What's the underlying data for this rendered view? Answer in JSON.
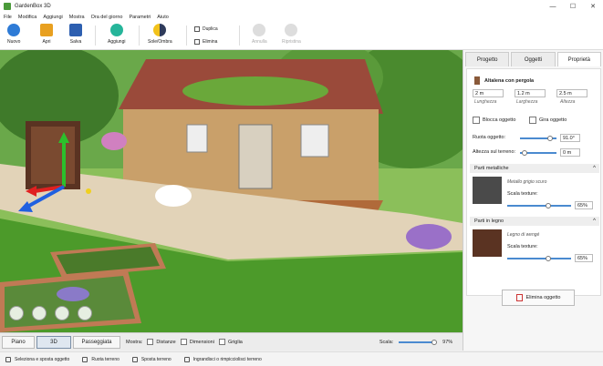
{
  "window": {
    "title": "GardenBox 3D"
  },
  "menu": [
    "File",
    "Modifica",
    "Aggiungi",
    "Mostra",
    "Ora del giorno",
    "Parametri",
    "Aiuto"
  ],
  "toolbar": {
    "nuovo": "Nuovo",
    "apri": "Apri",
    "salva": "Salva",
    "aggiungi": "Aggiungi",
    "sole_ombra": "Sole/Ombra",
    "duplica": "Duplica",
    "elimina": "Elimina",
    "annulla": "Annulla",
    "ripristina": "Ripristina"
  },
  "view": {
    "piano": "Piano",
    "three_d": "3D",
    "passeggiata": "Passeggiata",
    "mostra": "Mostra:",
    "distanze": "Distanze",
    "dimensioni": "Dimensioni",
    "griglia": "Griglia",
    "scala_label": "Scala:",
    "scala_value": "97%",
    "scala_fraction": 0.97
  },
  "status": [
    "Seleziona e sposta oggetto",
    "Ruota terreno",
    "Sposta terreno",
    "Ingrandisci o rimpicciolisci terreno"
  ],
  "panel": {
    "tabs": [
      "Progetto",
      "Oggetti",
      "Proprietà"
    ],
    "object_name": "Altalena con pergola",
    "dims": [
      {
        "value": "2 m",
        "label": "Lunghezza"
      },
      {
        "value": "1.2 m",
        "label": "Larghezza"
      },
      {
        "value": "2.5 m",
        "label": "Altezza"
      }
    ],
    "blocca": "Blocca oggetto",
    "gira": "Gira oggetto",
    "ruota_label": "Ruota oggetto:",
    "ruota_value": "91.0°",
    "altezza_label": "Altezza sul terreno:",
    "altezza_value": "0 m",
    "sections": [
      {
        "title": "Parti metalliche",
        "material": "Metallo grigio scuro",
        "texture_label": "Scala texture:",
        "texture_value": "65%",
        "color": "#4a4a4a"
      },
      {
        "title": "Parti in legno",
        "material": "Legno di wengé",
        "texture_label": "Scala texture:",
        "texture_value": "65%",
        "color": "#5a3322"
      }
    ],
    "delete_button": "Elimina oggetto"
  },
  "colors": {
    "accent": "#4a8ad0",
    "lawn": "#4c9a2a",
    "house": "#c9a06a",
    "roof": "#9a4a3a"
  }
}
